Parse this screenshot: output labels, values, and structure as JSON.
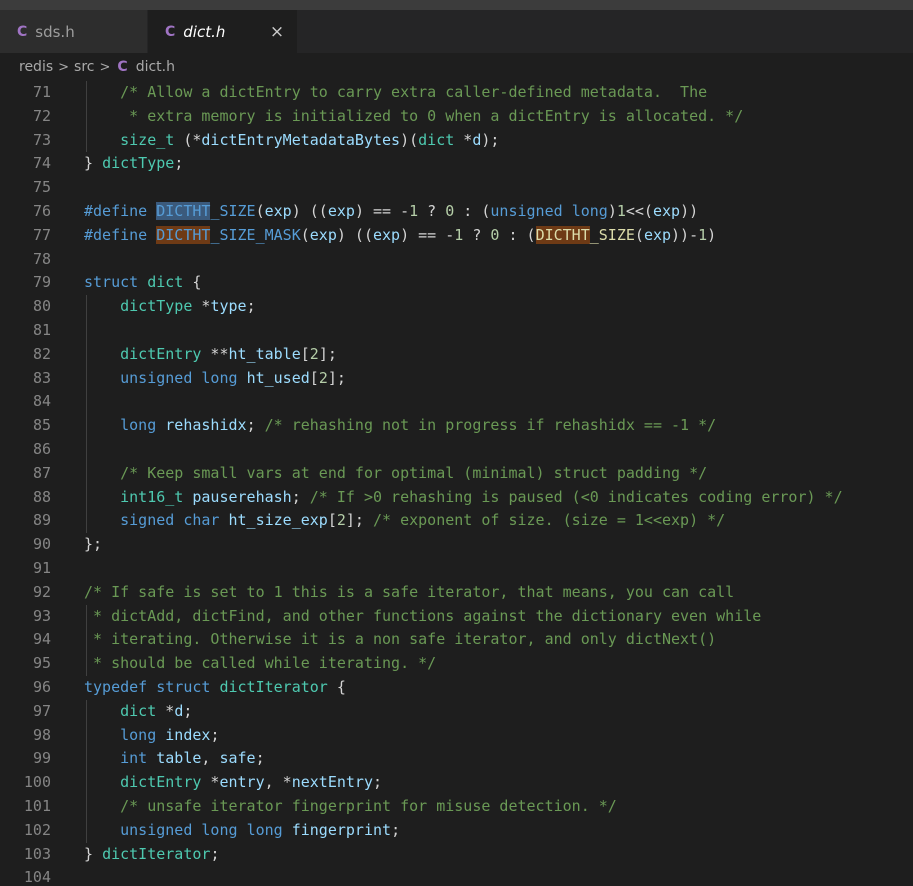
{
  "tabs": [
    {
      "icon": "C",
      "label": "sds.h"
    },
    {
      "icon": "C",
      "label": "dict.h",
      "close": "×"
    }
  ],
  "breadcrumb": {
    "items": [
      "redis",
      "src"
    ],
    "file_icon": "C",
    "file": "dict.h",
    "separator": ">"
  },
  "editor": {
    "line_numbers": [
      "71",
      "72",
      "73",
      "74",
      "75",
      "76",
      "77",
      "78",
      "79",
      "80",
      "81",
      "82",
      "83",
      "84",
      "85",
      "86",
      "87",
      "88",
      "89",
      "90",
      "91",
      "92",
      "93",
      "94",
      "95",
      "96",
      "97",
      "98",
      "99",
      "100",
      "101",
      "102",
      "103",
      "104"
    ],
    "lines": [
      [
        {
          "t": "    "
        },
        {
          "t": "/* Allow a dictEntry to carry extra caller-defined metadata.  The",
          "c": "ct"
        }
      ],
      [
        {
          "t": "     "
        },
        {
          "t": "* extra memory is initialized to 0 when a dictEntry is allocated. */",
          "c": "ct"
        }
      ],
      [
        {
          "t": "    "
        },
        {
          "t": "size_t",
          "c": "ty"
        },
        {
          "t": " (*"
        },
        {
          "t": "dictEntryMetadataBytes",
          "c": "vr"
        },
        {
          "t": ")("
        },
        {
          "t": "dict",
          "c": "ty"
        },
        {
          "t": " *"
        },
        {
          "t": "d",
          "c": "vr"
        },
        {
          "t": ");"
        }
      ],
      [
        {
          "t": "} "
        },
        {
          "t": "dictType",
          "c": "ty"
        },
        {
          "t": ";"
        }
      ],
      [
        {
          "t": ""
        }
      ],
      [
        {
          "t": "#define",
          "c": "mc"
        },
        {
          "t": " "
        },
        {
          "t": "DICTHT",
          "c": "mc",
          "h": "hl1"
        },
        {
          "t": "_SIZE",
          "c": "mc"
        },
        {
          "t": "("
        },
        {
          "t": "exp",
          "c": "vr"
        },
        {
          "t": ") (("
        },
        {
          "t": "exp",
          "c": "vr"
        },
        {
          "t": ") == -"
        },
        {
          "t": "1",
          "c": "nm"
        },
        {
          "t": " ? "
        },
        {
          "t": "0",
          "c": "nm"
        },
        {
          "t": " : ("
        },
        {
          "t": "unsigned",
          "c": "kw"
        },
        {
          "t": " "
        },
        {
          "t": "long",
          "c": "kw"
        },
        {
          "t": ")"
        },
        {
          "t": "1",
          "c": "nm"
        },
        {
          "t": "<<("
        },
        {
          "t": "exp",
          "c": "vr"
        },
        {
          "t": "))"
        }
      ],
      [
        {
          "t": "#define",
          "c": "mc"
        },
        {
          "t": " "
        },
        {
          "t": "DICTHT",
          "c": "mc",
          "h": "hl2"
        },
        {
          "t": "_SIZE_MASK",
          "c": "mc"
        },
        {
          "t": "("
        },
        {
          "t": "exp",
          "c": "vr"
        },
        {
          "t": ") (("
        },
        {
          "t": "exp",
          "c": "vr"
        },
        {
          "t": ") == -"
        },
        {
          "t": "1",
          "c": "nm"
        },
        {
          "t": " ? "
        },
        {
          "t": "0",
          "c": "nm"
        },
        {
          "t": " : ("
        },
        {
          "t": "DICTHT",
          "c": "fn",
          "h": "hl2"
        },
        {
          "t": "_SIZE",
          "c": "fn"
        },
        {
          "t": "("
        },
        {
          "t": "exp",
          "c": "vr"
        },
        {
          "t": "))-"
        },
        {
          "t": "1",
          "c": "nm"
        },
        {
          "t": ")"
        }
      ],
      [
        {
          "t": ""
        }
      ],
      [
        {
          "t": "struct",
          "c": "kw"
        },
        {
          "t": " "
        },
        {
          "t": "dict",
          "c": "ty"
        },
        {
          "t": " {"
        }
      ],
      [
        {
          "t": "    "
        },
        {
          "t": "dictType",
          "c": "ty"
        },
        {
          "t": " *"
        },
        {
          "t": "type",
          "c": "vr"
        },
        {
          "t": ";"
        }
      ],
      [
        {
          "t": ""
        }
      ],
      [
        {
          "t": "    "
        },
        {
          "t": "dictEntry",
          "c": "ty"
        },
        {
          "t": " **"
        },
        {
          "t": "ht_table",
          "c": "vr"
        },
        {
          "t": "["
        },
        {
          "t": "2",
          "c": "nm"
        },
        {
          "t": "];"
        }
      ],
      [
        {
          "t": "    "
        },
        {
          "t": "unsigned",
          "c": "kw"
        },
        {
          "t": " "
        },
        {
          "t": "long",
          "c": "kw"
        },
        {
          "t": " "
        },
        {
          "t": "ht_used",
          "c": "vr"
        },
        {
          "t": "["
        },
        {
          "t": "2",
          "c": "nm"
        },
        {
          "t": "];"
        }
      ],
      [
        {
          "t": ""
        }
      ],
      [
        {
          "t": "    "
        },
        {
          "t": "long",
          "c": "kw"
        },
        {
          "t": " "
        },
        {
          "t": "rehashidx",
          "c": "vr"
        },
        {
          "t": "; "
        },
        {
          "t": "/* rehashing not in progress if rehashidx == -1 */",
          "c": "ct"
        }
      ],
      [
        {
          "t": ""
        }
      ],
      [
        {
          "t": "    "
        },
        {
          "t": "/* Keep small vars at end for optimal (minimal) struct padding */",
          "c": "ct"
        }
      ],
      [
        {
          "t": "    "
        },
        {
          "t": "int16_t",
          "c": "ty"
        },
        {
          "t": " "
        },
        {
          "t": "pauserehash",
          "c": "vr"
        },
        {
          "t": "; "
        },
        {
          "t": "/* If >0 rehashing is paused (<0 indicates coding error) */",
          "c": "ct"
        }
      ],
      [
        {
          "t": "    "
        },
        {
          "t": "signed",
          "c": "kw"
        },
        {
          "t": " "
        },
        {
          "t": "char",
          "c": "kw"
        },
        {
          "t": " "
        },
        {
          "t": "ht_size_exp",
          "c": "vr"
        },
        {
          "t": "["
        },
        {
          "t": "2",
          "c": "nm"
        },
        {
          "t": "]; "
        },
        {
          "t": "/* exponent of size. (size = 1<<exp) */",
          "c": "ct"
        }
      ],
      [
        {
          "t": "};"
        }
      ],
      [
        {
          "t": ""
        }
      ],
      [
        {
          "t": "/* If safe is set to 1 this is a safe iterator, that means, you can call",
          "c": "ct"
        }
      ],
      [
        {
          "t": " * dictAdd, dictFind, and other functions against the dictionary even while",
          "c": "ct"
        }
      ],
      [
        {
          "t": " * iterating. Otherwise it is a non safe iterator, and only dictNext()",
          "c": "ct"
        }
      ],
      [
        {
          "t": " * should be called while iterating. */",
          "c": "ct"
        }
      ],
      [
        {
          "t": "typedef",
          "c": "kw"
        },
        {
          "t": " "
        },
        {
          "t": "struct",
          "c": "kw"
        },
        {
          "t": " "
        },
        {
          "t": "dictIterator",
          "c": "ty"
        },
        {
          "t": " {"
        }
      ],
      [
        {
          "t": "    "
        },
        {
          "t": "dict",
          "c": "ty"
        },
        {
          "t": " *"
        },
        {
          "t": "d",
          "c": "vr"
        },
        {
          "t": ";"
        }
      ],
      [
        {
          "t": "    "
        },
        {
          "t": "long",
          "c": "kw"
        },
        {
          "t": " "
        },
        {
          "t": "index",
          "c": "vr"
        },
        {
          "t": ";"
        }
      ],
      [
        {
          "t": "    "
        },
        {
          "t": "int",
          "c": "kw"
        },
        {
          "t": " "
        },
        {
          "t": "table",
          "c": "vr"
        },
        {
          "t": ", "
        },
        {
          "t": "safe",
          "c": "vr"
        },
        {
          "t": ";"
        }
      ],
      [
        {
          "t": "    "
        },
        {
          "t": "dictEntry",
          "c": "ty"
        },
        {
          "t": " *"
        },
        {
          "t": "entry",
          "c": "vr"
        },
        {
          "t": ", *"
        },
        {
          "t": "nextEntry",
          "c": "vr"
        },
        {
          "t": ";"
        }
      ],
      [
        {
          "t": "    "
        },
        {
          "t": "/* unsafe iterator fingerprint for misuse detection. */",
          "c": "ct"
        }
      ],
      [
        {
          "t": "    "
        },
        {
          "t": "unsigned",
          "c": "kw"
        },
        {
          "t": " "
        },
        {
          "t": "long",
          "c": "kw"
        },
        {
          "t": " "
        },
        {
          "t": "long",
          "c": "kw"
        },
        {
          "t": " "
        },
        {
          "t": "fingerprint",
          "c": "vr"
        },
        {
          "t": ";"
        }
      ],
      [
        {
          "t": "} "
        },
        {
          "t": "dictIterator",
          "c": "ty"
        },
        {
          "t": ";"
        }
      ],
      [
        {
          "t": ""
        }
      ]
    ]
  }
}
